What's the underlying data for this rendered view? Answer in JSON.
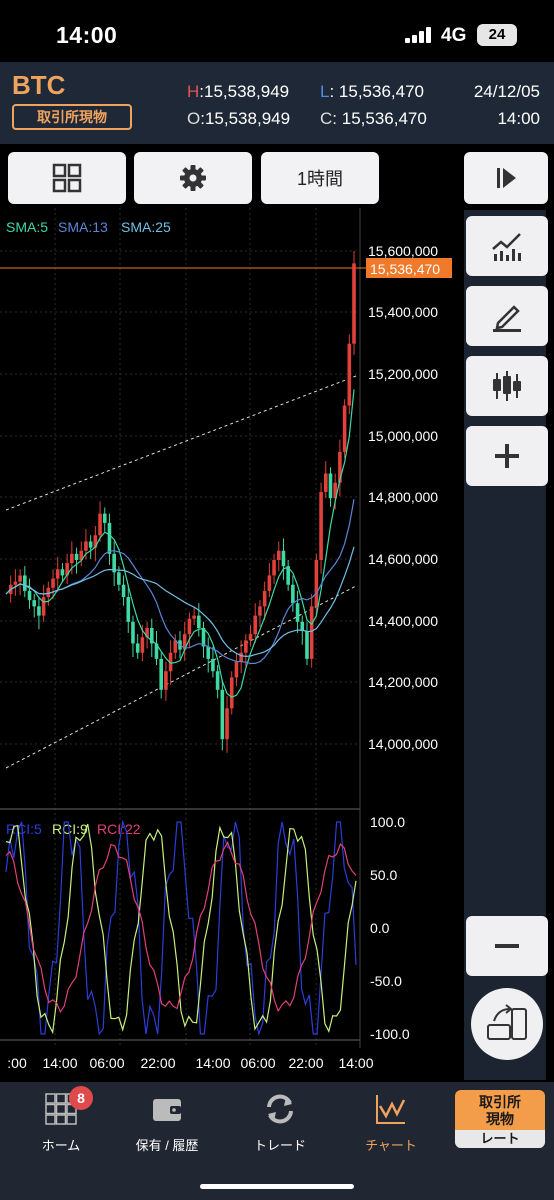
{
  "status_bar": {
    "time": "14:00",
    "network": "4G",
    "battery": "24"
  },
  "header": {
    "symbol": "BTC",
    "market": "取引所現物",
    "high_label": "H",
    "high": "15,538,949",
    "low_label": "L",
    "low": "15,536,470",
    "open_label": "O",
    "open": "15,538,949",
    "close_label": "C",
    "close": "15,536,470",
    "date": "24/12/05",
    "time": "14:00"
  },
  "toolbar": {
    "interval": "1時間"
  },
  "chart": {
    "sma_labels": [
      "SMA:5",
      "SMA:13",
      "SMA:25"
    ],
    "price_axis": [
      "15,600,000",
      "15,400,000",
      "15,200,000",
      "15,000,000",
      "14,800,000",
      "14,600,000",
      "14,400,000",
      "14,200,000",
      "14,000,000"
    ],
    "current_price": "15,536,470",
    "rci_labels": [
      "RCI:5",
      "RCI:9",
      "RCI:22"
    ],
    "rci_axis": [
      "100.0",
      "50.0",
      "0.0",
      "-50.0",
      "-100.0"
    ],
    "time_axis": [
      ":00",
      "14:00",
      "06:00",
      "22:00",
      "14:00",
      "06:00",
      "22:00",
      "14:00"
    ],
    "colors": {
      "sma5": "#3fd9a4",
      "sma13": "#5b86d8",
      "sma25": "#6fc1e6",
      "up": "#e0413a",
      "down": "#3fd9a4",
      "price_line": "#f07a2a",
      "rci5": "#2a3ed8",
      "rci9": "#c8f07a",
      "rci22": "#e0407a"
    }
  },
  "nav": {
    "items": [
      "ホーム",
      "保有 / 履歴",
      "トレード",
      "チャート"
    ],
    "badge": "8",
    "rate_button": "取引所\n現物",
    "rate_button_sub": "レート"
  }
}
